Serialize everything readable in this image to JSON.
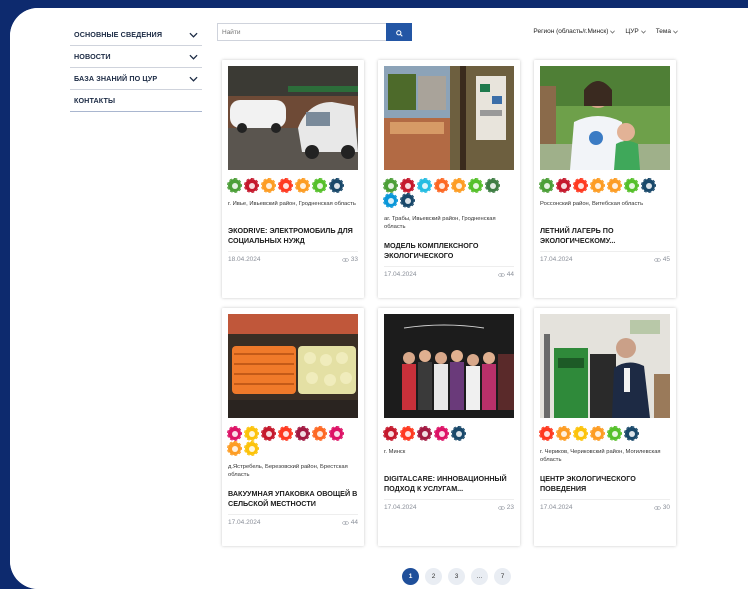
{
  "sidebar": {
    "items": [
      {
        "label": "ОСНОВНЫЕ СВЕДЕНИЯ",
        "has_chevron": true
      },
      {
        "label": "НОВОСТИ",
        "has_chevron": true
      },
      {
        "label": "БАЗА ЗНАНИЙ ПО ЦУР",
        "has_chevron": true
      },
      {
        "label": "КОНТАКТЫ",
        "has_chevron": false
      }
    ]
  },
  "search": {
    "placeholder": "Найти",
    "icon": "search-icon"
  },
  "filters": {
    "region": "Регион (область/г.Минск)",
    "sdg": "ЦУР",
    "topic": "Тема"
  },
  "colors": {
    "brand": "#0d2a6e",
    "accent": "#2356a5",
    "active_page": "#1f4f9a"
  },
  "cards": [
    {
      "location": "г. Ивье, Ивьевский район, Гродненская область",
      "title": "ЭКОDRIVE: ЭЛЕКТРОМОБИЛЬ ДЛЯ СОЦИАЛЬНЫХ НУЖД",
      "date": "18.04.2024",
      "views": "33",
      "sdg_colors": [
        "#4c9f38",
        "#c5192d",
        "#fd9d24",
        "#ff3a21",
        "#fd9d24",
        "#56c02b",
        "#19486a"
      ]
    },
    {
      "location": "аг. Трабы, Ивьевский район, Гродненская область",
      "title": "МОДЕЛЬ КОМПЛЕКСНОГО ЭКОЛОГИЧЕСКОГО ПРОСВЕЩЕНИ...",
      "date": "17.04.2024",
      "views": "44",
      "sdg_colors": [
        "#4c9f38",
        "#c5192d",
        "#26bde2",
        "#fd6925",
        "#fd9d24",
        "#56c02b",
        "#3f7e44",
        "#0a97d9",
        "#19486a"
      ]
    },
    {
      "location": "Россонский район, Витебская область",
      "title": "ЛЕТНИЙ ЛАГЕРЬ ПО ЭКОЛОГИЧЕСКОМУ...",
      "date": "17.04.2024",
      "views": "45",
      "sdg_colors": [
        "#4c9f38",
        "#c5192d",
        "#ff3a21",
        "#fd9d24",
        "#fd9d24",
        "#56c02b",
        "#19486a"
      ]
    },
    {
      "location": "д.Ястребель, Березовский район, Брестская область",
      "title": "ВАКУУМНАЯ УПАКОВКА ОВОЩЕЙ В СЕЛЬСКОЙ МЕСТНОСТИ",
      "date": "17.04.2024",
      "views": "44",
      "sdg_colors": [
        "#dd1367",
        "#fcc30b",
        "#c5192d",
        "#ff3a21",
        "#a21942",
        "#fd6925",
        "#dd1367",
        "#fd9d24",
        "#fcc30b"
      ]
    },
    {
      "location": "г. Минск",
      "title": "DIGITALCARE: ИННОВАЦИОННЫЙ ПОДХОД К УСЛУГАМ...",
      "date": "17.04.2024",
      "views": "23",
      "sdg_colors": [
        "#c5192d",
        "#ff3a21",
        "#a21942",
        "#dd1367",
        "#19486a"
      ]
    },
    {
      "location": "г. Чериков, Чериковский район, Могилевская область",
      "title": "ЦЕНТР ЭКОЛОГИЧЕСКОГО ПОВЕДЕНИЯ",
      "date": "17.04.2024",
      "views": "30",
      "sdg_colors": [
        "#ff3a21",
        "#fd9d24",
        "#fcc30b",
        "#fd9d24",
        "#56c02b",
        "#19486a"
      ]
    }
  ],
  "pagination": {
    "pages": [
      "1",
      "2",
      "3",
      "...",
      "7"
    ],
    "active": "1"
  }
}
